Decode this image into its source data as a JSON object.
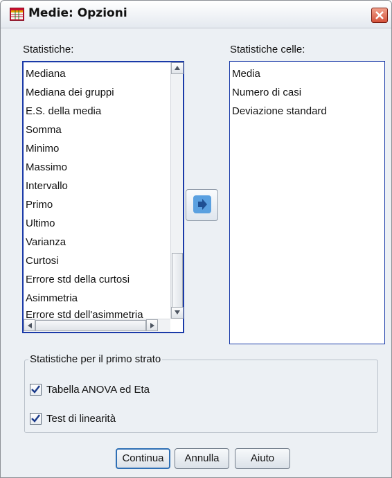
{
  "window": {
    "title": "Medie: Opzioni",
    "icon": "table-app-icon"
  },
  "title_bar": {
    "close_icon": "close-icon"
  },
  "statistics": {
    "label": "Statistiche:",
    "items": [
      "Mediana",
      "Mediana dei gruppi",
      "E.S. della media",
      "Somma",
      "Minimo",
      "Massimo",
      "Intervallo",
      "Primo",
      "Ultimo",
      "Varianza",
      "Curtosi",
      "Errore std della curtosi",
      "Asimmetria",
      "Errore std dell'asimmetria"
    ]
  },
  "cell_statistics": {
    "label": "Statistiche celle:",
    "items": [
      "Media",
      "Numero di casi",
      "Deviazione standard"
    ]
  },
  "move_button": {
    "icon": "arrow-right-icon"
  },
  "first_layer": {
    "legend": "Statistiche per il primo strato",
    "anova": {
      "label": "Tabella ANOVA ed Eta",
      "checked": true
    },
    "linearity": {
      "label": "Test di linearità",
      "checked": true
    }
  },
  "buttons": {
    "continue": "Continua",
    "cancel": "Annulla",
    "help": "Aiuto"
  },
  "colors": {
    "list_border": "#1a3aa8",
    "move_arrow": "#2a6fbd",
    "close_button": "#d4513a"
  }
}
